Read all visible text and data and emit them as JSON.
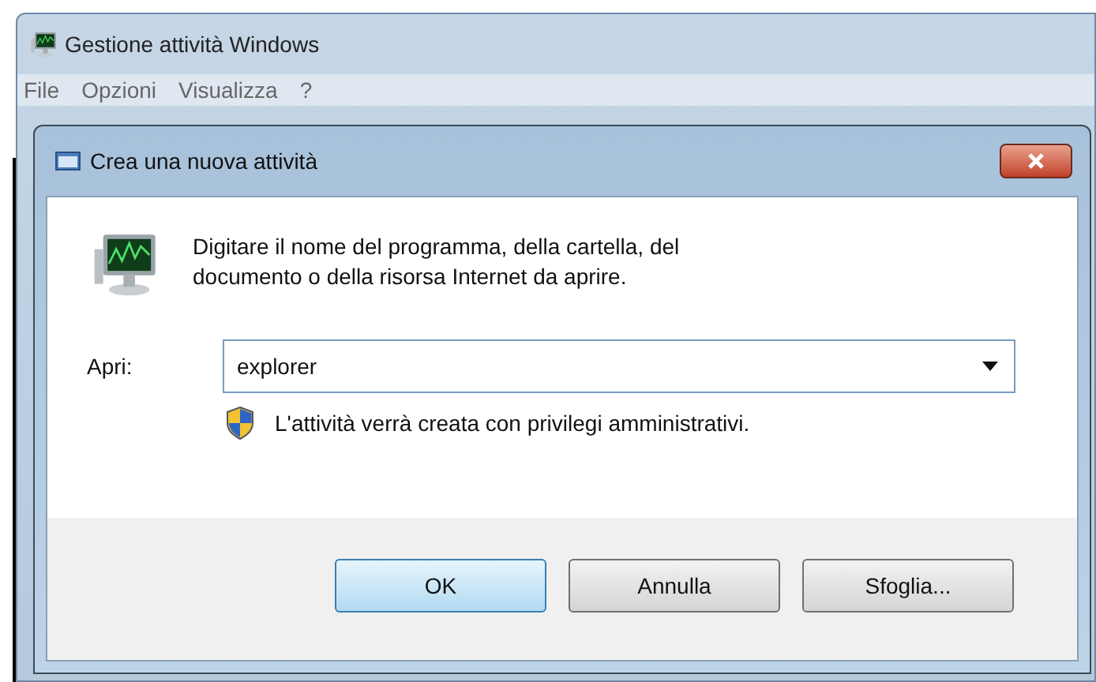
{
  "window": {
    "title": "Gestione attività Windows"
  },
  "menu": [
    {
      "label": "File"
    },
    {
      "label": "Opzioni"
    },
    {
      "label": "Visualizza"
    },
    {
      "label": "?"
    }
  ],
  "dialog": {
    "title": "Crea una nuova attività",
    "description": "Digitare il nome del programma, della cartella, del documento o della risorsa Internet da aprire.",
    "field_label": "Apri:",
    "field_value": "explorer",
    "note": "L'attività verrà creata con privilegi amministrativi.",
    "buttons": [
      {
        "label": "OK",
        "default": true
      },
      {
        "label": "Annulla",
        "default": false
      },
      {
        "label": "Sfoglia...",
        "default": false
      }
    ]
  }
}
